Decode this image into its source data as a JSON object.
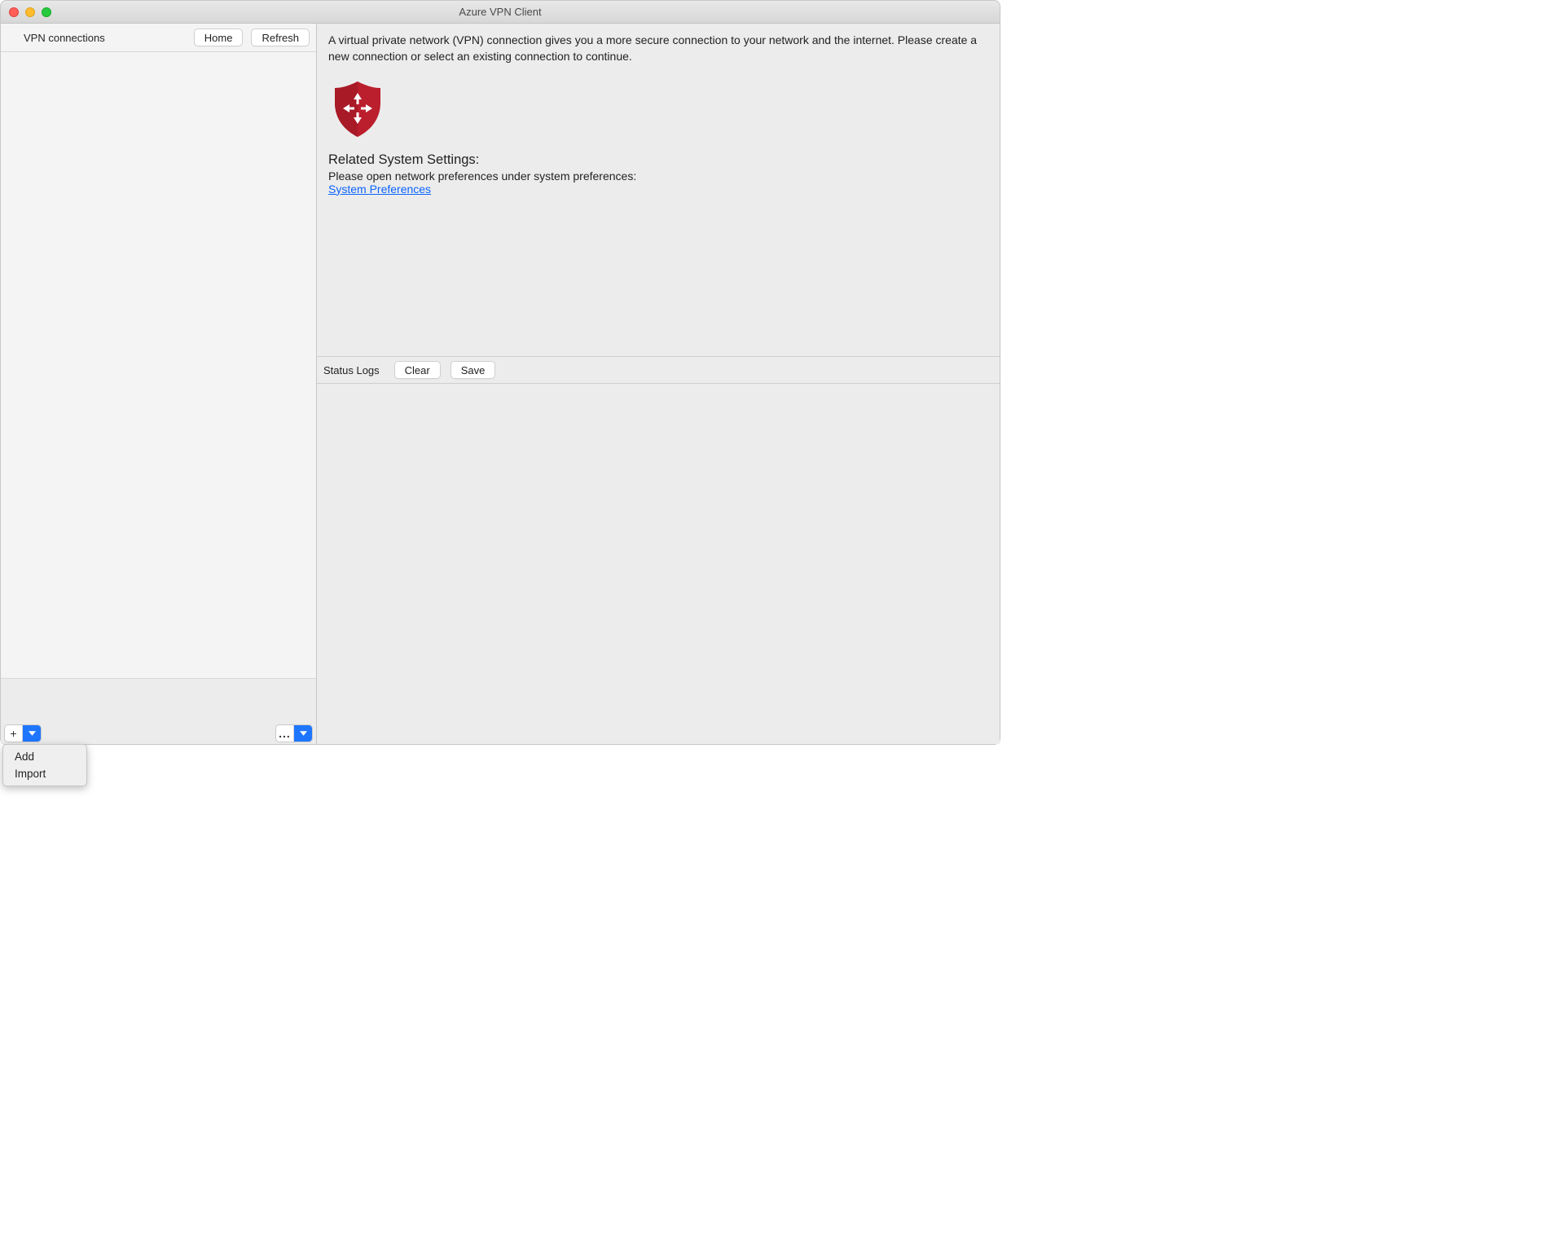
{
  "window": {
    "title": "Azure VPN Client"
  },
  "sidebar": {
    "heading": "VPN connections",
    "home_button": "Home",
    "refresh_button": "Refresh",
    "add_combo_label": "+",
    "more_combo_label": "...",
    "menu": {
      "add": "Add",
      "import": "Import"
    }
  },
  "main": {
    "intro": "A virtual private network (VPN) connection gives you a more secure connection to your network and the internet. Please create a new connection or select an existing connection to continue.",
    "settings_heading": "Related System Settings:",
    "settings_text": "Please open network preferences under system preferences:",
    "sys_pref_link": "System Preferences"
  },
  "logs": {
    "heading": "Status Logs",
    "clear_button": "Clear",
    "save_button": "Save"
  },
  "colors": {
    "shield": "#bb1e2c"
  }
}
